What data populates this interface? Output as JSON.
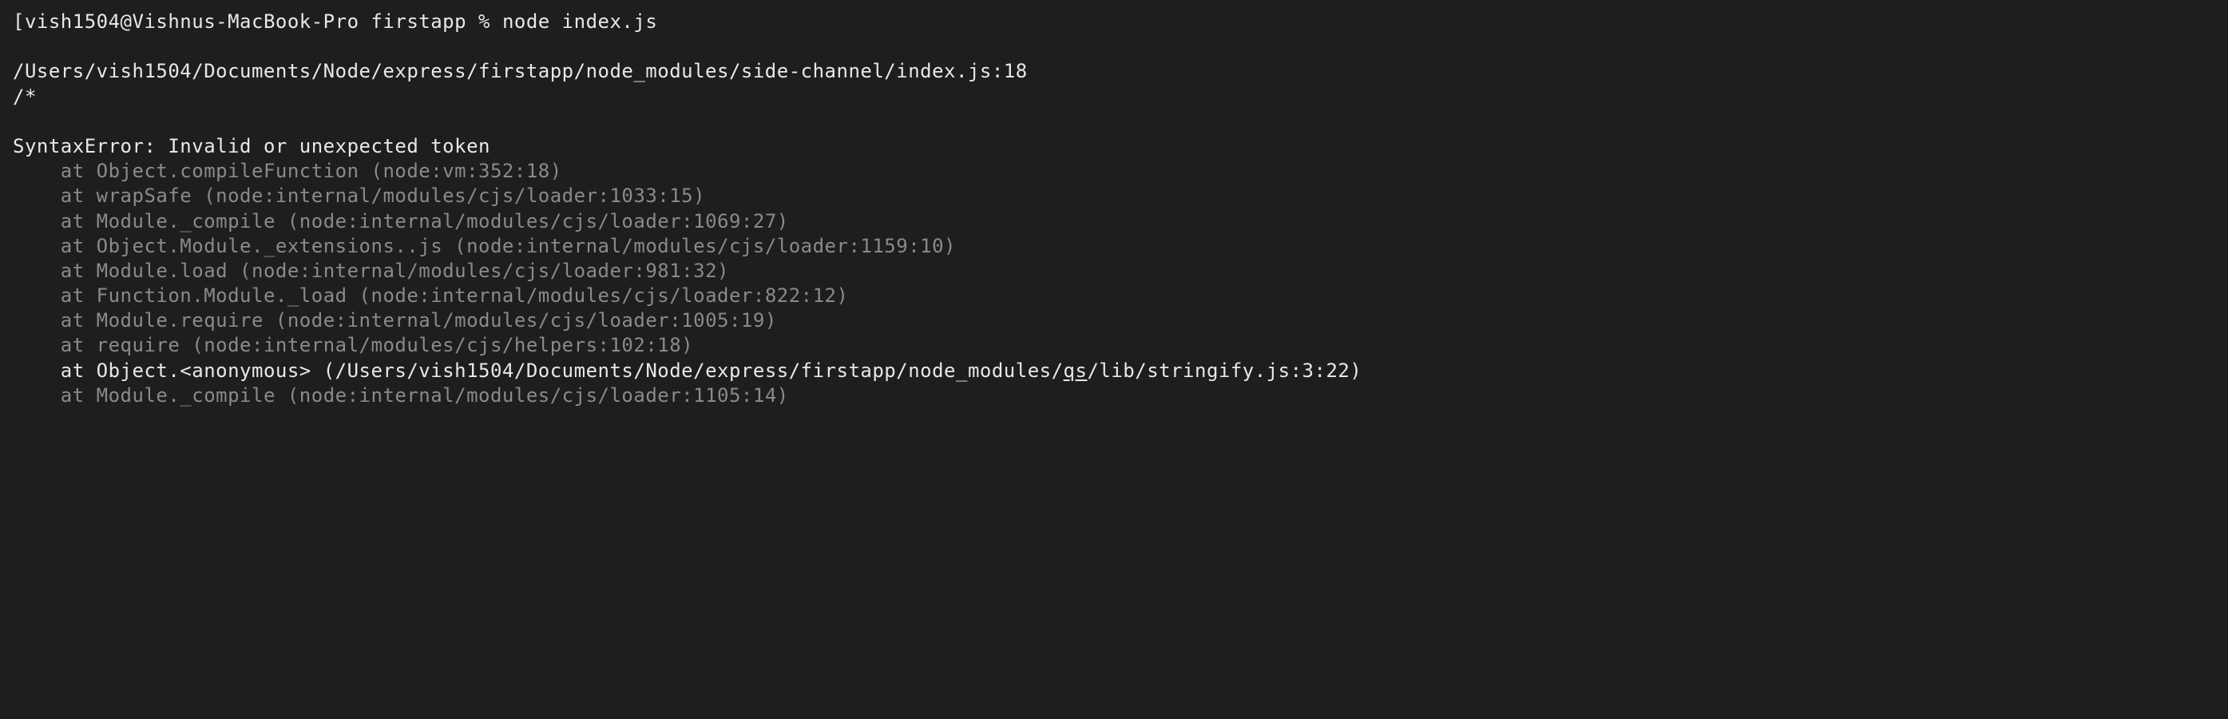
{
  "terminal": {
    "prompt_open": "[",
    "prompt_user_host": "vish1504@Vishnus-MacBook-Pro",
    "prompt_dir": "firstapp",
    "prompt_symbol": "%",
    "command": "node index.js",
    "file_path_line": "/Users/vish1504/Documents/Node/express/firstapp/node_modules/side-channel/index.js:18",
    "snippet_line": "/*",
    "error_type": "SyntaxError:",
    "error_message": "Invalid or unexpected token",
    "stack_prefix": "    at ",
    "stack": [
      "Object.compileFunction (node:vm:352:18)",
      "wrapSafe (node:internal/modules/cjs/loader:1033:15)",
      "Module._compile (node:internal/modules/cjs/loader:1069:27)",
      "Object.Module._extensions..js (node:internal/modules/cjs/loader:1159:10)",
      "Module.load (node:internal/modules/cjs/loader:981:32)",
      "Function.Module._load (node:internal/modules/cjs/loader:822:12)",
      "Module.require (node:internal/modules/cjs/loader:1005:19)",
      "require (node:internal/modules/cjs/helpers:102:18)"
    ],
    "stack_highlight_pre": "Object.<anonymous> (/Users/vish1504/Documents/Node/express/firstapp/node_modules/",
    "stack_highlight_underlined": "qs",
    "stack_highlight_post": "/lib/stringify.js:3:22)",
    "stack_after": [
      "Module._compile (node:internal/modules/cjs/loader:1105:14)"
    ]
  }
}
